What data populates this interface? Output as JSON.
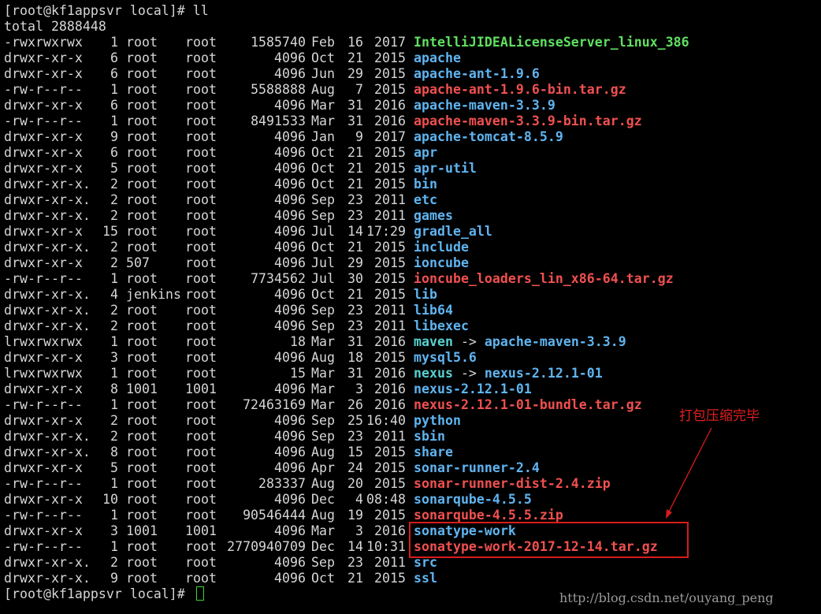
{
  "colors": {
    "text": "#d6d6d6",
    "dir": "#5fb4f0",
    "archive": "#f05050",
    "exec": "#60e060",
    "link": "#57d0d0",
    "annotation": "#d81c1c",
    "cursor": "#3cd23c"
  },
  "terminal": {
    "prompt_top": "[root@kf1appsvr local]# ll",
    "total": "total 2888448",
    "entries": [
      {
        "perm": "-rwxrwxrwx",
        "links": "1",
        "owner": "root",
        "group": "root",
        "size": "1585740",
        "month": "Feb",
        "day": "16",
        "time": "2017",
        "name": "IntelliJIDEALicenseServer_linux_386",
        "kind": "exec"
      },
      {
        "perm": "drwxr-xr-x",
        "links": "6",
        "owner": "root",
        "group": "root",
        "size": "4096",
        "month": "Oct",
        "day": "21",
        "time": "2015",
        "name": "apache",
        "kind": "dir"
      },
      {
        "perm": "drwxr-xr-x",
        "links": "6",
        "owner": "root",
        "group": "root",
        "size": "4096",
        "month": "Jun",
        "day": "29",
        "time": "2015",
        "name": "apache-ant-1.9.6",
        "kind": "dir"
      },
      {
        "perm": "-rw-r--r--",
        "links": "1",
        "owner": "root",
        "group": "root",
        "size": "5588888",
        "month": "Aug",
        "day": "7",
        "time": "2015",
        "name": "apache-ant-1.9.6-bin.tar.gz",
        "kind": "archive"
      },
      {
        "perm": "drwxr-xr-x",
        "links": "6",
        "owner": "root",
        "group": "root",
        "size": "4096",
        "month": "Mar",
        "day": "31",
        "time": "2016",
        "name": "apache-maven-3.3.9",
        "kind": "dir"
      },
      {
        "perm": "-rw-r--r--",
        "links": "1",
        "owner": "root",
        "group": "root",
        "size": "8491533",
        "month": "Mar",
        "day": "31",
        "time": "2016",
        "name": "apache-maven-3.3.9-bin.tar.gz",
        "kind": "archive"
      },
      {
        "perm": "drwxr-xr-x",
        "links": "9",
        "owner": "root",
        "group": "root",
        "size": "4096",
        "month": "Jan",
        "day": "9",
        "time": "2017",
        "name": "apache-tomcat-8.5.9",
        "kind": "dir"
      },
      {
        "perm": "drwxr-xr-x",
        "links": "6",
        "owner": "root",
        "group": "root",
        "size": "4096",
        "month": "Oct",
        "day": "21",
        "time": "2015",
        "name": "apr",
        "kind": "dir"
      },
      {
        "perm": "drwxr-xr-x",
        "links": "5",
        "owner": "root",
        "group": "root",
        "size": "4096",
        "month": "Oct",
        "day": "21",
        "time": "2015",
        "name": "apr-util",
        "kind": "dir"
      },
      {
        "perm": "drwxr-xr-x.",
        "links": "2",
        "owner": "root",
        "group": "root",
        "size": "4096",
        "month": "Oct",
        "day": "21",
        "time": "2015",
        "name": "bin",
        "kind": "dir"
      },
      {
        "perm": "drwxr-xr-x.",
        "links": "2",
        "owner": "root",
        "group": "root",
        "size": "4096",
        "month": "Sep",
        "day": "23",
        "time": "2011",
        "name": "etc",
        "kind": "dir"
      },
      {
        "perm": "drwxr-xr-x.",
        "links": "2",
        "owner": "root",
        "group": "root",
        "size": "4096",
        "month": "Sep",
        "day": "23",
        "time": "2011",
        "name": "games",
        "kind": "dir"
      },
      {
        "perm": "drwxr-xr-x",
        "links": "15",
        "owner": "root",
        "group": "root",
        "size": "4096",
        "month": "Jul",
        "day": "14",
        "time": "17:29",
        "name": "gradle_all",
        "kind": "dir"
      },
      {
        "perm": "drwxr-xr-x.",
        "links": "2",
        "owner": "root",
        "group": "root",
        "size": "4096",
        "month": "Oct",
        "day": "21",
        "time": "2015",
        "name": "include",
        "kind": "dir"
      },
      {
        "perm": "drwxr-xr-x",
        "links": "2",
        "owner": "507",
        "group": "root",
        "size": "4096",
        "month": "Jul",
        "day": "29",
        "time": "2015",
        "name": "ioncube",
        "kind": "dir"
      },
      {
        "perm": "-rw-r--r--",
        "links": "1",
        "owner": "root",
        "group": "root",
        "size": "7734562",
        "month": "Jul",
        "day": "30",
        "time": "2015",
        "name": "ioncube_loaders_lin_x86-64.tar.gz",
        "kind": "archive"
      },
      {
        "perm": "drwxr-xr-x.",
        "links": "4",
        "owner": "jenkins",
        "group": "root",
        "size": "4096",
        "month": "Oct",
        "day": "21",
        "time": "2015",
        "name": "lib",
        "kind": "dir"
      },
      {
        "perm": "drwxr-xr-x.",
        "links": "2",
        "owner": "root",
        "group": "root",
        "size": "4096",
        "month": "Sep",
        "day": "23",
        "time": "2011",
        "name": "lib64",
        "kind": "dir"
      },
      {
        "perm": "drwxr-xr-x.",
        "links": "2",
        "owner": "root",
        "group": "root",
        "size": "4096",
        "month": "Sep",
        "day": "23",
        "time": "2011",
        "name": "libexec",
        "kind": "dir"
      },
      {
        "perm": "lrwxrwxrwx",
        "links": "1",
        "owner": "root",
        "group": "root",
        "size": "18",
        "month": "Mar",
        "day": "31",
        "time": "2016",
        "name": "maven",
        "kind": "link",
        "target": "apache-maven-3.3.9"
      },
      {
        "perm": "drwxr-xr-x",
        "links": "3",
        "owner": "root",
        "group": "root",
        "size": "4096",
        "month": "Aug",
        "day": "18",
        "time": "2015",
        "name": "mysql5.6",
        "kind": "dir"
      },
      {
        "perm": "lrwxrwxrwx",
        "links": "1",
        "owner": "root",
        "group": "root",
        "size": "15",
        "month": "Mar",
        "day": "31",
        "time": "2016",
        "name": "nexus",
        "kind": "link",
        "target": "nexus-2.12.1-01"
      },
      {
        "perm": "drwxr-xr-x",
        "links": "8",
        "owner": "1001",
        "group": "1001",
        "size": "4096",
        "month": "Mar",
        "day": "3",
        "time": "2016",
        "name": "nexus-2.12.1-01",
        "kind": "dir"
      },
      {
        "perm": "-rw-r--r--",
        "links": "1",
        "owner": "root",
        "group": "root",
        "size": "72463169",
        "month": "Mar",
        "day": "26",
        "time": "2016",
        "name": "nexus-2.12.1-01-bundle.tar.gz",
        "kind": "archive"
      },
      {
        "perm": "drwxr-xr-x",
        "links": "2",
        "owner": "root",
        "group": "root",
        "size": "4096",
        "month": "Sep",
        "day": "25",
        "time": "16:40",
        "name": "python",
        "kind": "dir"
      },
      {
        "perm": "drwxr-xr-x.",
        "links": "2",
        "owner": "root",
        "group": "root",
        "size": "4096",
        "month": "Sep",
        "day": "23",
        "time": "2011",
        "name": "sbin",
        "kind": "dir"
      },
      {
        "perm": "drwxr-xr-x.",
        "links": "8",
        "owner": "root",
        "group": "root",
        "size": "4096",
        "month": "Aug",
        "day": "15",
        "time": "2015",
        "name": "share",
        "kind": "dir"
      },
      {
        "perm": "drwxr-xr-x",
        "links": "5",
        "owner": "root",
        "group": "root",
        "size": "4096",
        "month": "Apr",
        "day": "24",
        "time": "2015",
        "name": "sonar-runner-2.4",
        "kind": "dir"
      },
      {
        "perm": "-rw-r--r--",
        "links": "1",
        "owner": "root",
        "group": "root",
        "size": "283337",
        "month": "Aug",
        "day": "20",
        "time": "2015",
        "name": "sonar-runner-dist-2.4.zip",
        "kind": "archive"
      },
      {
        "perm": "drwxr-xr-x",
        "links": "10",
        "owner": "root",
        "group": "root",
        "size": "4096",
        "month": "Dec",
        "day": "4",
        "time": "08:48",
        "name": "sonarqube-4.5.5",
        "kind": "dir"
      },
      {
        "perm": "-rw-r--r--",
        "links": "1",
        "owner": "root",
        "group": "root",
        "size": "90546444",
        "month": "Aug",
        "day": "19",
        "time": "2015",
        "name": "sonarqube-4.5.5.zip",
        "kind": "archive"
      },
      {
        "perm": "drwxr-xr-x",
        "links": "3",
        "owner": "1001",
        "group": "1001",
        "size": "4096",
        "month": "Mar",
        "day": "3",
        "time": "2016",
        "name": "sonatype-work",
        "kind": "dir"
      },
      {
        "perm": "-rw-r--r--",
        "links": "1",
        "owner": "root",
        "group": "root",
        "size": "2770940709",
        "month": "Dec",
        "day": "14",
        "time": "10:31",
        "name": "sonatype-work-2017-12-14.tar.gz",
        "kind": "archive"
      },
      {
        "perm": "drwxr-xr-x.",
        "links": "2",
        "owner": "root",
        "group": "root",
        "size": "4096",
        "month": "Sep",
        "day": "23",
        "time": "2011",
        "name": "src",
        "kind": "dir"
      },
      {
        "perm": "drwxr-xr-x.",
        "links": "9",
        "owner": "root",
        "group": "root",
        "size": "4096",
        "month": "Oct",
        "day": "21",
        "time": "2015",
        "name": "ssl",
        "kind": "dir"
      }
    ],
    "prompt_bottom": "[root@kf1appsvr local]# "
  },
  "annotation": {
    "text": "打包压缩完毕"
  },
  "watermark": "http://blog.csdn.net/ouyang_peng"
}
